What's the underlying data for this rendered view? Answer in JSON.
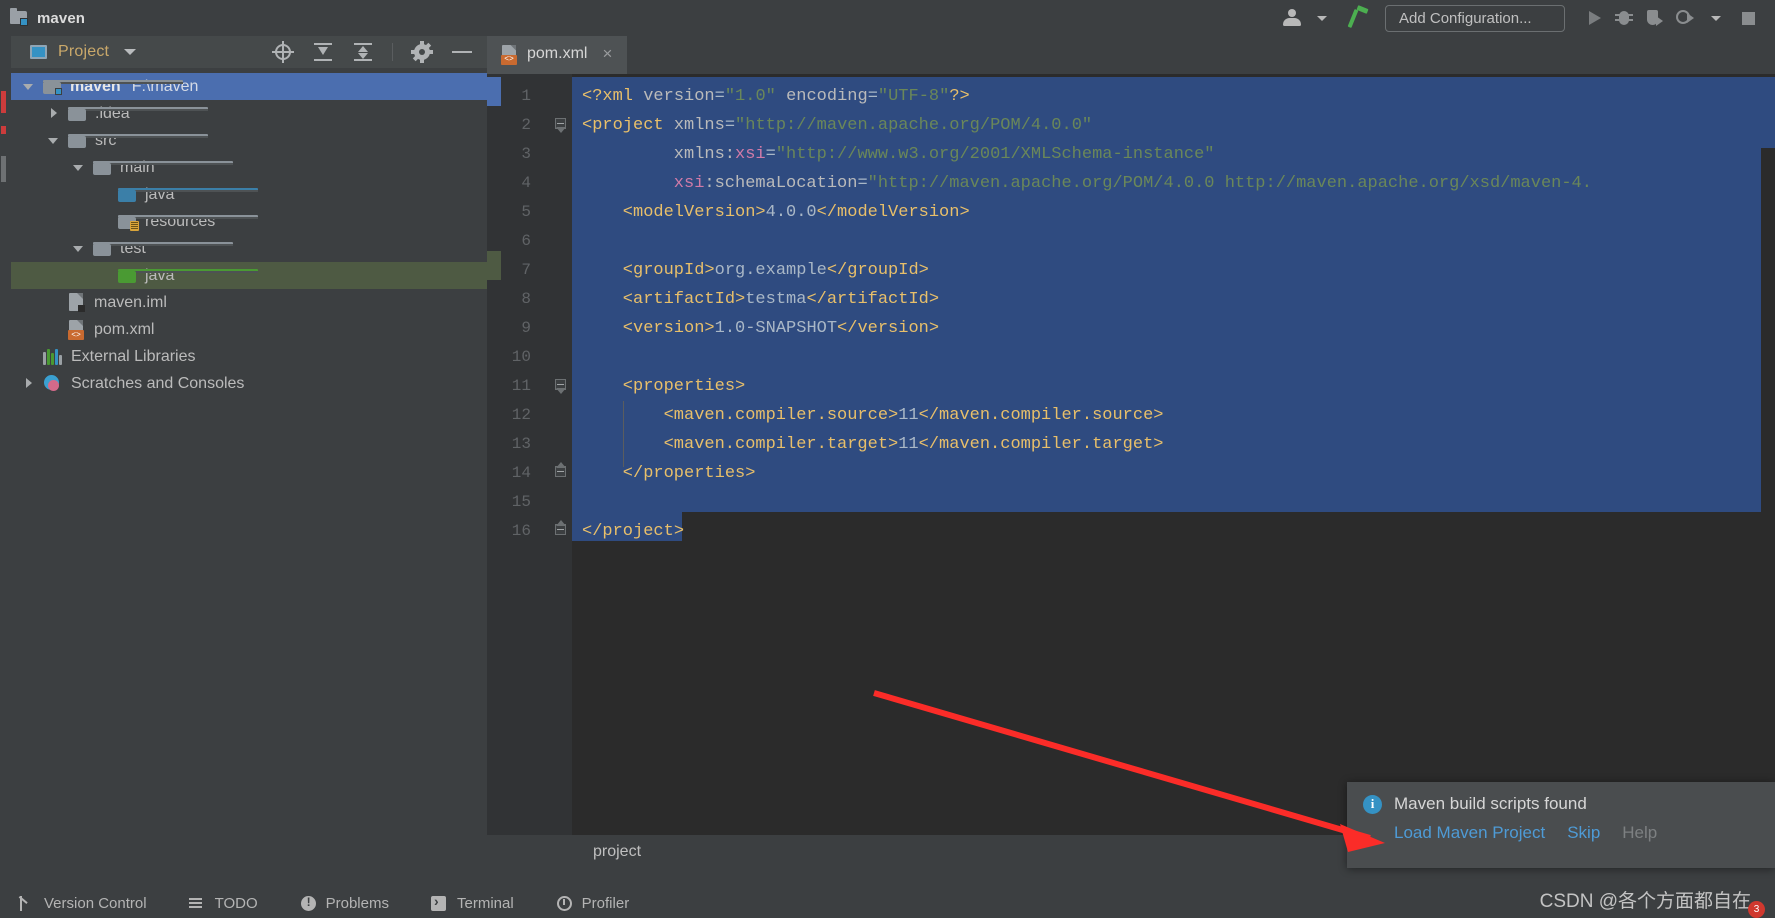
{
  "titlebar": {
    "project_name": "maven",
    "add_configuration_label": "Add Configuration...",
    "icons": {
      "user": "user-account-icon",
      "user_caret": "chevron-down-icon",
      "build": "hammer-build-icon",
      "run": "run-icon",
      "debug": "debug-bug-icon",
      "coverage": "run-with-coverage-icon",
      "profile": "profiler-icon",
      "more_caret": "chevron-down-icon",
      "stop": "stop-icon"
    }
  },
  "project_panel": {
    "title": "Project",
    "toolbar": {
      "locate": "select-opened-file-icon",
      "expand": "expand-all-icon",
      "collapse": "collapse-all-icon",
      "settings": "gear-icon",
      "hide": "hide-panel-icon"
    },
    "tree": [
      {
        "label": "maven",
        "path": "F:\\maven",
        "icon": "project-folder-icon",
        "arrow": "down",
        "depth": 0,
        "state": "selected",
        "bold": true
      },
      {
        "label": ".idea",
        "path": "",
        "icon": "folder-icon",
        "arrow": "right",
        "depth": 1,
        "state": "normal",
        "bold": false
      },
      {
        "label": "src",
        "path": "",
        "icon": "folder-icon",
        "arrow": "down",
        "depth": 1,
        "state": "normal",
        "bold": false
      },
      {
        "label": "main",
        "path": "",
        "icon": "folder-icon",
        "arrow": "down",
        "depth": 2,
        "state": "normal",
        "bold": false
      },
      {
        "label": "java",
        "path": "",
        "icon": "source-root-folder-icon",
        "arrow": "none",
        "depth": 3,
        "state": "normal",
        "bold": false
      },
      {
        "label": "resources",
        "path": "",
        "icon": "resources-root-folder-icon",
        "arrow": "none",
        "depth": 3,
        "state": "normal",
        "bold": false
      },
      {
        "label": "test",
        "path": "",
        "icon": "folder-icon",
        "arrow": "down",
        "depth": 2,
        "state": "normal",
        "bold": false
      },
      {
        "label": "java",
        "path": "",
        "icon": "test-source-root-folder-icon",
        "arrow": "none",
        "depth": 3,
        "state": "green-selected",
        "bold": false
      },
      {
        "label": "maven.iml",
        "path": "",
        "icon": "iml-file-icon",
        "arrow": "none",
        "depth": 1,
        "state": "normal",
        "bold": false
      },
      {
        "label": "pom.xml",
        "path": "",
        "icon": "xml-file-icon",
        "arrow": "none",
        "depth": 1,
        "state": "normal",
        "bold": false
      },
      {
        "label": "External Libraries",
        "path": "",
        "icon": "libraries-icon",
        "arrow": "none",
        "depth": 0,
        "state": "normal",
        "bold": false
      },
      {
        "label": "Scratches and Consoles",
        "path": "",
        "icon": "scratches-icon",
        "arrow": "right",
        "depth": 0,
        "state": "normal",
        "bold": false
      }
    ]
  },
  "editor": {
    "tab": {
      "label": "pom.xml",
      "close": "×",
      "icon": "xml-file-icon"
    },
    "breadcrumb": "project",
    "line_numbers": [
      1,
      2,
      3,
      4,
      5,
      6,
      7,
      8,
      9,
      10,
      11,
      12,
      13,
      14,
      15,
      16
    ],
    "lines": [
      {
        "n": 1,
        "indent": 0,
        "segments": [
          {
            "t": "<?xml ",
            "c": "k-pi"
          },
          {
            "t": "version",
            "c": "k-attr"
          },
          {
            "t": "=",
            "c": "k-punct"
          },
          {
            "t": "\"1.0\"",
            "c": "k-str"
          },
          {
            "t": " ",
            "c": "k-punct"
          },
          {
            "t": "encoding",
            "c": "k-attr"
          },
          {
            "t": "=",
            "c": "k-punct"
          },
          {
            "t": "\"UTF-8\"",
            "c": "k-str"
          },
          {
            "t": "?>",
            "c": "k-pi"
          }
        ]
      },
      {
        "n": 2,
        "indent": 0,
        "segments": [
          {
            "t": "<project ",
            "c": "k-tag"
          },
          {
            "t": "xmlns",
            "c": "k-attr"
          },
          {
            "t": "=",
            "c": "k-punct"
          },
          {
            "t": "\"http://maven.apache.org/POM/4.0.0\"",
            "c": "k-str"
          }
        ]
      },
      {
        "n": 3,
        "indent": 9,
        "segments": [
          {
            "t": "xmlns:",
            "c": "k-attr"
          },
          {
            "t": "xsi",
            "c": "k-ns"
          },
          {
            "t": "=",
            "c": "k-punct"
          },
          {
            "t": "\"http://www.w3.org/2001/XMLSchema-instance\"",
            "c": "k-str"
          }
        ]
      },
      {
        "n": 4,
        "indent": 9,
        "segments": [
          {
            "t": "xsi",
            "c": "k-ns"
          },
          {
            "t": ":schemaLocation",
            "c": "k-attr"
          },
          {
            "t": "=",
            "c": "k-punct"
          },
          {
            "t": "\"http://maven.apache.org/POM/4.0.0 http://maven.apache.org/xsd/maven-4.",
            "c": "k-str"
          }
        ]
      },
      {
        "n": 5,
        "indent": 4,
        "segments": [
          {
            "t": "<modelVersion>",
            "c": "k-tag"
          },
          {
            "t": "4.0.0",
            "c": "k-text"
          },
          {
            "t": "</modelVersion>",
            "c": "k-tag"
          }
        ]
      },
      {
        "n": 6,
        "indent": 0,
        "segments": []
      },
      {
        "n": 7,
        "indent": 4,
        "segments": [
          {
            "t": "<groupId>",
            "c": "k-tag"
          },
          {
            "t": "org.example",
            "c": "k-text"
          },
          {
            "t": "</groupId>",
            "c": "k-tag"
          }
        ]
      },
      {
        "n": 8,
        "indent": 4,
        "segments": [
          {
            "t": "<artifactId>",
            "c": "k-tag"
          },
          {
            "t": "testma",
            "c": "k-text"
          },
          {
            "t": "</artifactId>",
            "c": "k-tag"
          }
        ]
      },
      {
        "n": 9,
        "indent": 4,
        "segments": [
          {
            "t": "<version>",
            "c": "k-tag"
          },
          {
            "t": "1.0-SNAPSHOT",
            "c": "k-text"
          },
          {
            "t": "</version>",
            "c": "k-tag"
          }
        ]
      },
      {
        "n": 10,
        "indent": 0,
        "segments": []
      },
      {
        "n": 11,
        "indent": 4,
        "segments": [
          {
            "t": "<properties>",
            "c": "k-tag"
          }
        ]
      },
      {
        "n": 12,
        "indent": 8,
        "segments": [
          {
            "t": "<maven.compiler.source>",
            "c": "k-tag"
          },
          {
            "t": "11",
            "c": "k-text"
          },
          {
            "t": "</maven.compiler.source>",
            "c": "k-tag"
          }
        ]
      },
      {
        "n": 13,
        "indent": 8,
        "segments": [
          {
            "t": "<maven.compiler.target>",
            "c": "k-tag"
          },
          {
            "t": "11",
            "c": "k-text"
          },
          {
            "t": "</maven.compiler.target>",
            "c": "k-tag"
          }
        ]
      },
      {
        "n": 14,
        "indent": 4,
        "segments": [
          {
            "t": "</properties>",
            "c": "k-tag"
          }
        ]
      },
      {
        "n": 15,
        "indent": 0,
        "segments": []
      },
      {
        "n": 16,
        "indent": 0,
        "segments": [
          {
            "t": "</project>",
            "c": "k-tag"
          }
        ]
      }
    ]
  },
  "notification": {
    "icon": "info-icon",
    "icon_glyph": "i",
    "title": "Maven build scripts found",
    "actions": [
      {
        "label": "Load Maven Project",
        "state": "enabled"
      },
      {
        "label": "Skip",
        "state": "enabled"
      },
      {
        "label": "Help",
        "state": "disabled"
      }
    ]
  },
  "bottombar": {
    "items": [
      {
        "label": "Version Control",
        "icon": "version-control-icon"
      },
      {
        "label": "TODO",
        "icon": "todo-list-icon"
      },
      {
        "label": "Problems",
        "icon": "problems-icon"
      },
      {
        "label": "Terminal",
        "icon": "terminal-icon"
      },
      {
        "label": "Profiler",
        "icon": "profiler-icon"
      }
    ]
  },
  "watermark": {
    "text": "CSDN @各个方面都自在",
    "badge": "3"
  },
  "colors": {
    "accent_blue": "#3592c4",
    "selection_blue": "#4b6eaf",
    "code_selection": "#2f4b80",
    "green_selection": "#4e5a43",
    "link_blue": "#4e9bd6",
    "arrow_red": "#fb2c28",
    "tag_orange": "#c96a30",
    "editor_bg": "#2b2b2b",
    "panel_bg": "#3c3f41"
  }
}
